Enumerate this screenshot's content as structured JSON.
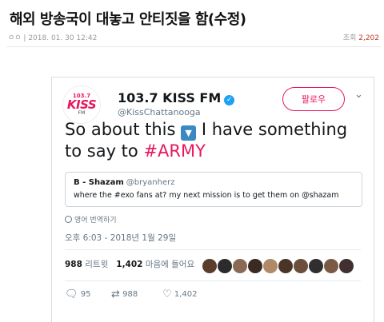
{
  "post": {
    "title": "해외 방송국이 대놓고 안티짓을 함(수정)",
    "meta": "ㅇㅇ | 2018. 01. 30 12:42",
    "views_label": "조회",
    "views_count": "2,202"
  },
  "tweet": {
    "avatar": {
      "top": "103.7",
      "brand": "KISS",
      "sub": "FM"
    },
    "display_name": "103.7 KISS FM",
    "handle": "@KissChattanooga",
    "follow_label": "팔로우",
    "text_1": "So about this",
    "emoji": "▼",
    "text_2": "I have something to say to",
    "hashtag": "#ARMY",
    "quote": {
      "name": "B - Shazam",
      "handle": "@bryanherz",
      "text": "where the #exo fans at? my next mission is to get them on @shazam"
    },
    "translate_label": "영어 번역하기",
    "date": "오후 6:03 - 2018년 1월 29일",
    "stats": {
      "retweets_count": "988",
      "retweets_label": "리트윗",
      "likes_count": "1,402",
      "likes_label": "마음에 들어요"
    },
    "liker_avatar_colors": [
      "#5a3d2b",
      "#2b2b2b",
      "#8a6a55",
      "#3a2a22",
      "#b08968",
      "#4a3426",
      "#6b4f3a",
      "#2f2f2f",
      "#7b5a45",
      "#403030"
    ],
    "actions": {
      "reply_count": "95",
      "retweet_count": "988",
      "like_count": "1,402"
    }
  },
  "colors": {
    "brand_pink": "#e8175d",
    "verified_blue": "#1da1f2",
    "muted": "#657786"
  }
}
